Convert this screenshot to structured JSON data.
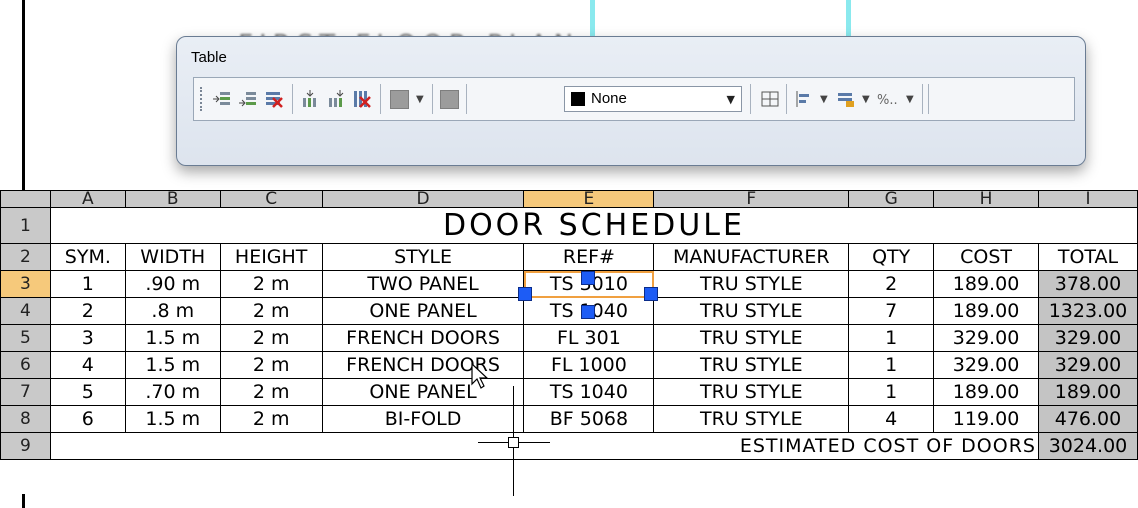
{
  "drawing": {
    "background_title": "FIRST FLOOR PLAN"
  },
  "toolbar": {
    "title": "Table",
    "cell_color_value": "None",
    "icons": [
      "insert-row-above-icon",
      "insert-row-below-icon",
      "delete-row-icon",
      "insert-column-left-icon",
      "insert-column-right-icon",
      "delete-column-icon",
      "merge-cells-icon",
      "cell-background-color-icon",
      "cell-borders-icon",
      "alignment-icon",
      "locking-icon",
      "data-format-icon"
    ]
  },
  "table": {
    "column_headers": [
      "A",
      "B",
      "C",
      "D",
      "E",
      "F",
      "G",
      "H",
      "I"
    ],
    "selected_column": "E",
    "selected_row": "3",
    "row_numbers": [
      "1",
      "2",
      "3",
      "4",
      "5",
      "6",
      "7",
      "8",
      "9"
    ],
    "title": "DOOR SCHEDULE",
    "headers": [
      "SYM.",
      "WIDTH",
      "HEIGHT",
      "STYLE",
      "REF#",
      "MANUFACTURER",
      "QTY",
      "COST",
      "TOTAL"
    ],
    "rows": [
      [
        "1",
        ".90 m",
        "2 m",
        "TWO PANEL",
        "TS 3010",
        "TRU STYLE",
        "2",
        "189.00",
        "378.00"
      ],
      [
        "2",
        ".8 m",
        "2 m",
        "ONE PANEL",
        "TS 1040",
        "TRU STYLE",
        "7",
        "189.00",
        "1323.00"
      ],
      [
        "3",
        "1.5 m",
        "2 m",
        "FRENCH DOORS",
        "FL 301",
        "TRU STYLE",
        "1",
        "329.00",
        "329.00"
      ],
      [
        "4",
        "1.5 m",
        "2 m",
        "FRENCH DOORS",
        "FL 1000",
        "TRU STYLE",
        "1",
        "329.00",
        "329.00"
      ],
      [
        "5",
        ".70 m",
        "2 m",
        "ONE PANEL",
        "TS 1040",
        "TRU STYLE",
        "1",
        "189.00",
        "189.00"
      ],
      [
        "6",
        "1.5 m",
        "2 m",
        "BI-FOLD",
        "BF 5068",
        "TRU STYLE",
        "4",
        "119.00",
        "476.00"
      ]
    ],
    "footer_label": "ESTIMATED COST OF DOORS",
    "footer_total": "3024.00"
  },
  "colors": {
    "selection_header": "#f6c97b",
    "grip": "#1d5cf5",
    "header_grey": "#c9c9c9"
  }
}
